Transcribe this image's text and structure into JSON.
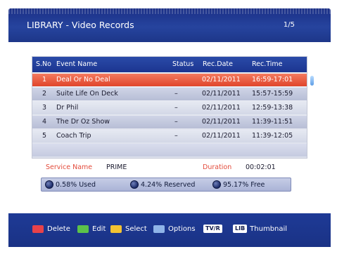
{
  "header": {
    "title": "LIBRARY - Video Records",
    "page": "1/5"
  },
  "table": {
    "columns": [
      "S.No",
      "Event Name",
      "Status",
      "Rec.Date",
      "Rec.Time"
    ],
    "rows": [
      {
        "no": "1",
        "name": "Deal Or No Deal",
        "status": "–",
        "date": "02/11/2011",
        "time": "16:59-17:01",
        "selected": true
      },
      {
        "no": "2",
        "name": "Suite Life On Deck",
        "status": "–",
        "date": "02/11/2011",
        "time": "15:57-15:59",
        "selected": false
      },
      {
        "no": "3",
        "name": "Dr Phil",
        "status": "–",
        "date": "02/11/2011",
        "time": "12:59-13:38",
        "selected": false
      },
      {
        "no": "4",
        "name": "The Dr Oz Show",
        "status": "–",
        "date": "02/11/2011",
        "time": "11:39-11:51",
        "selected": false
      },
      {
        "no": "5",
        "name": "Coach Trip",
        "status": "–",
        "date": "02/11/2011",
        "time": "11:39-12:05",
        "selected": false
      }
    ]
  },
  "info": {
    "service_label": "Service Name",
    "service_value": "PRIME",
    "duration_label": "Duration",
    "duration_value": "00:02:01"
  },
  "usage": {
    "used": "0.58% Used",
    "reserved": "4.24% Reserved",
    "free": "95.17% Free"
  },
  "footer": {
    "keys": [
      {
        "color": "#e8424a",
        "label": "Delete"
      },
      {
        "color": "#5cc24a",
        "label": "Edit"
      },
      {
        "color": "#f2c232",
        "label": "Select"
      },
      {
        "color": "#8fb4e8",
        "label": "Options"
      }
    ],
    "tvr_chip": "TV/R",
    "lib_chip": "LIB",
    "thumbnail_label": "Thumbnail"
  }
}
